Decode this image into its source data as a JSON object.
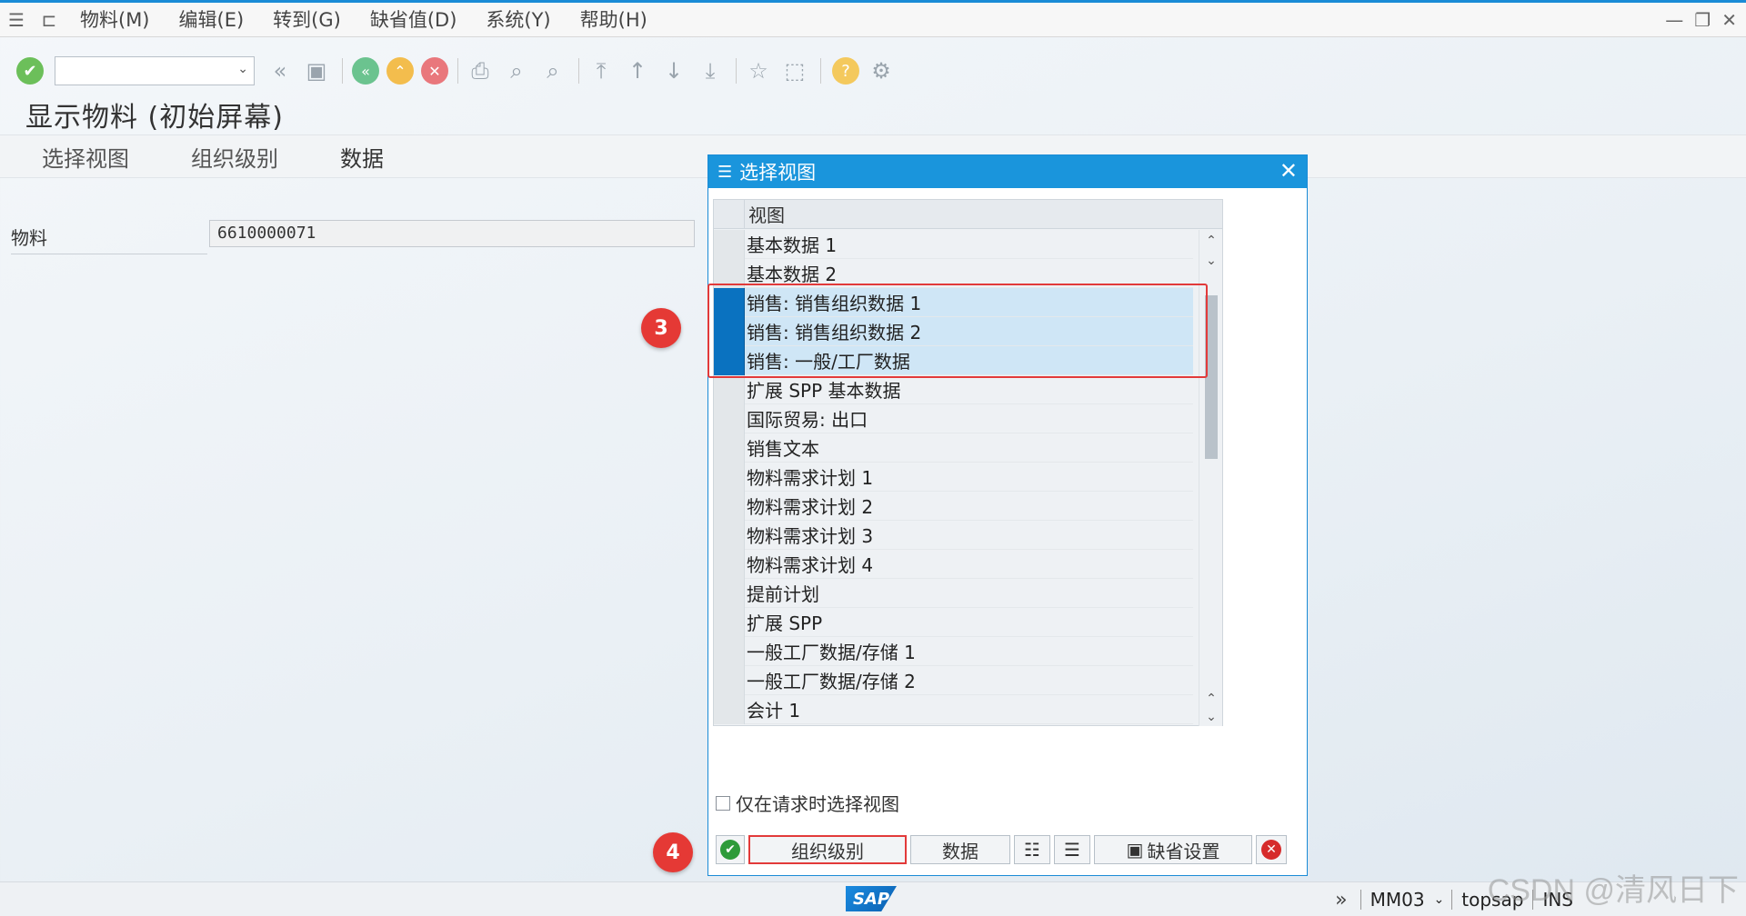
{
  "menubar": {
    "items": [
      "物料(M)",
      "编辑(E)",
      "转到(G)",
      "缺省值(D)",
      "系统(Y)",
      "帮助(H)"
    ]
  },
  "page": {
    "title": "显示物料 (初始屏幕)"
  },
  "appbar": {
    "buttons": [
      "选择视图",
      "组织级别",
      "数据"
    ]
  },
  "material": {
    "label": "物料",
    "value": "6610000071"
  },
  "dialog": {
    "title": "选择视图",
    "column_header": "视图",
    "rows": [
      {
        "label": "基本数据 1",
        "selected": false
      },
      {
        "label": "基本数据 2",
        "selected": false
      },
      {
        "label": "销售: 销售组织数据 1",
        "selected": true
      },
      {
        "label": "销售: 销售组织数据 2",
        "selected": true
      },
      {
        "label": "销售: 一般/工厂数据",
        "selected": true
      },
      {
        "label": "扩展 SPP 基本数据",
        "selected": false
      },
      {
        "label": "国际贸易: 出口",
        "selected": false
      },
      {
        "label": "销售文本",
        "selected": false
      },
      {
        "label": "物料需求计划 1",
        "selected": false
      },
      {
        "label": "物料需求计划 2",
        "selected": false
      },
      {
        "label": "物料需求计划 3",
        "selected": false
      },
      {
        "label": "物料需求计划 4",
        "selected": false
      },
      {
        "label": "提前计划",
        "selected": false
      },
      {
        "label": "扩展 SPP",
        "selected": false
      },
      {
        "label": "一般工厂数据/存储 1",
        "selected": false
      },
      {
        "label": "一般工厂数据/存储 2",
        "selected": false
      },
      {
        "label": "会计 1",
        "selected": false
      }
    ],
    "checkbox_label": "仅在请求时选择视图",
    "buttons": {
      "org_level": "组织级别",
      "data": "数据",
      "default_settings": "缺省设置"
    }
  },
  "annotations": {
    "step3": "3",
    "step4": "4"
  },
  "statusbar": {
    "logo": "SAP",
    "transaction": "MM03",
    "system": "topsap",
    "mode": "INS"
  },
  "watermark": "CSDN @清风日下"
}
